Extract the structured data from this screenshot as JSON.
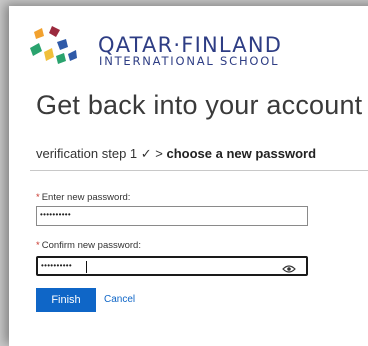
{
  "logo": {
    "title": "QATAR·FINLAND",
    "subtitle": "INTERNATIONAL SCHOOL",
    "colors": [
      "#f2a12e",
      "#9b2a3e",
      "#2aa36e",
      "#2f5aa8"
    ]
  },
  "page": {
    "heading": "Get back into your account"
  },
  "steps": {
    "previous": "verification step 1 ✓ >",
    "current": "choose a new password"
  },
  "form": {
    "new_password": {
      "label": "Enter new password:",
      "required_mark": "*",
      "value": "••••••••••"
    },
    "confirm_password": {
      "label": "Confirm new password:",
      "required_mark": "*",
      "value": "••••••••••"
    }
  },
  "actions": {
    "finish_label": "Finish",
    "cancel_label": "Cancel"
  },
  "colors": {
    "brand_navy": "#2e3d84",
    "primary": "#0f66c7",
    "required": "#c8352b"
  }
}
